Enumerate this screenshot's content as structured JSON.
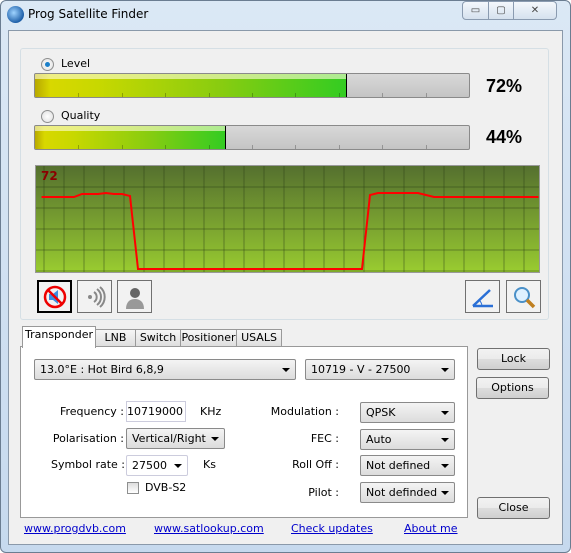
{
  "window": {
    "title": "Prog Satellite Finder",
    "minimize": "▭",
    "maximize": "▢",
    "close": "✕"
  },
  "meters": {
    "level": {
      "label": "Level",
      "percent": 72,
      "text": "72%",
      "selected": true
    },
    "quality": {
      "label": "Quality",
      "percent": 44,
      "text": "44%",
      "selected": false
    }
  },
  "chart_data": {
    "type": "line",
    "current_label": "72",
    "ylim": [
      0,
      100
    ],
    "grid": true,
    "line_color": "#ff0000",
    "values": [
      72,
      72,
      72,
      72,
      72,
      75,
      75,
      75,
      76,
      75,
      75,
      73,
      0,
      0,
      0,
      0,
      0,
      0,
      0,
      0,
      0,
      0,
      0,
      0,
      0,
      0,
      0,
      0,
      0,
      0,
      0,
      0,
      0,
      0,
      0,
      0,
      0,
      0,
      0,
      0,
      0,
      74,
      76,
      76,
      76,
      76,
      76,
      76,
      74,
      72,
      72,
      72,
      72,
      72,
      72,
      72,
      72,
      72,
      72,
      72,
      72,
      72,
      72
    ]
  },
  "toolbar": {
    "icons": [
      "mute-icon",
      "sound-icon",
      "user-icon",
      "angle-icon",
      "search-icon"
    ]
  },
  "tabs": [
    "Transponder",
    "LNB",
    "Switch",
    "Positioner",
    "USALS"
  ],
  "transponder": {
    "satellite": "13.0°E : Hot Bird 6,8,9",
    "tp": "10719 - V - 27500",
    "frequency_label": "Frequency :",
    "frequency": "10719000",
    "frequency_unit": "KHz",
    "polarisation_label": "Polarisation :",
    "polarisation": "Vertical/Right",
    "symbol_label": "Symbol rate :",
    "symbol": "27500",
    "symbol_unit": "Ks",
    "dvbs2_label": "DVB-S2",
    "dvbs2": false,
    "modulation_label": "Modulation :",
    "modulation": "QPSK",
    "fec_label": "FEC :",
    "fec": "Auto",
    "rolloff_label": "Roll Off :",
    "rolloff": "Not defined",
    "pilot_label": "Pilot :",
    "pilot": "Not definded"
  },
  "buttons": {
    "lock": "Lock",
    "options": "Options",
    "close": "Close"
  },
  "links": [
    "www.progdvb.com",
    "www.satlookup.com",
    "Check updates",
    "About me"
  ]
}
